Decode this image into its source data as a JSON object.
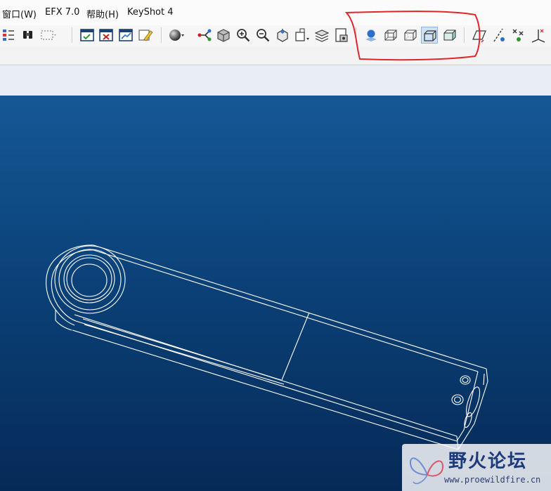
{
  "menubar": {
    "items": [
      "窗口(W)",
      "EFX 7.0",
      "帮助(H)",
      "KeyShot 4"
    ]
  },
  "toolbar": {
    "tools": [
      "regenerate-icon",
      "find-icon",
      "select-box-icon",
      "window-activate-icon",
      "window-close-icon",
      "chart-edit-icon",
      "model-check-icon",
      "sphere-shading-icon",
      "datum-tree-icon",
      "repaint-icon",
      "zoom-in-icon",
      "zoom-out-icon",
      "refit-icon",
      "named-view-icon",
      "layers-icon",
      "view-manager-icon",
      "shading-icon",
      "wireframe-icon",
      "hidden-line-icon",
      "no-hidden-icon",
      "shaded-cube-icon",
      "datum-plane-icon",
      "datum-axis-icon",
      "datum-point-icon",
      "coordinate-system-icon"
    ],
    "active_tool": "no-hidden-icon"
  },
  "watermark": {
    "title": "野火论坛",
    "url": "www.proewildfire.cn"
  },
  "colors": {
    "viewport_top": "#155896",
    "viewport_bottom": "#062a58",
    "wireframe": "#ffffff",
    "annotation": "#e0262b"
  }
}
